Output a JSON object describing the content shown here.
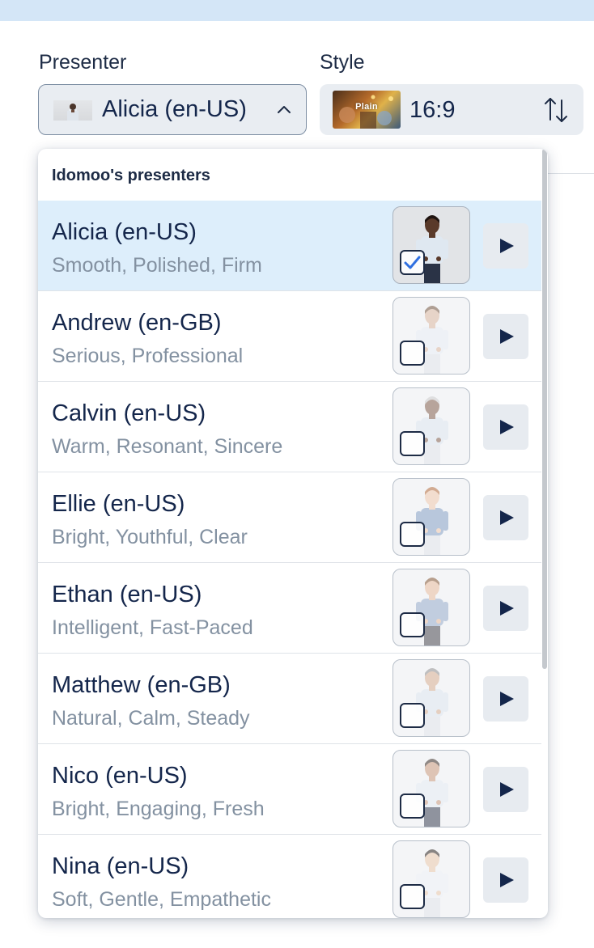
{
  "presenter_field": {
    "label": "Presenter",
    "selected_value": "Alicia (en-US)"
  },
  "style_field": {
    "label": "Style",
    "thumbnail_label": "Plain",
    "ratio": "16:9"
  },
  "dropdown": {
    "header": "Idomoo's presenters",
    "presenters": [
      {
        "name": "Alicia (en-US)",
        "traits": "Smooth, Polished, Firm",
        "checked": true
      },
      {
        "name": "Andrew (en-GB)",
        "traits": "Serious, Professional",
        "checked": false
      },
      {
        "name": "Calvin (en-US)",
        "traits": "Warm, Resonant, Sincere",
        "checked": false
      },
      {
        "name": "Ellie (en-US)",
        "traits": "Bright, Youthful, Clear",
        "checked": false
      },
      {
        "name": "Ethan (en-US)",
        "traits": "Intelligent, Fast-Paced",
        "checked": false
      },
      {
        "name": "Matthew (en-GB)",
        "traits": "Natural, Calm, Steady",
        "checked": false
      },
      {
        "name": "Nico (en-US)",
        "traits": "Bright, Engaging, Fresh",
        "checked": false
      },
      {
        "name": "Nina (en-US)",
        "traits": "Soft, Gentle, Empathetic",
        "checked": false
      }
    ]
  },
  "icons": {
    "presenter_dropdown": "chevron-up-icon",
    "style_swap": "swap-vertical-icon",
    "play": "play-icon",
    "check": "checkmark-icon"
  },
  "colors": {
    "selected_row_bg": "#ddeefb",
    "text_primary": "#14264b",
    "text_secondary": "#8391a1",
    "checkmark": "#2f6fe0"
  }
}
